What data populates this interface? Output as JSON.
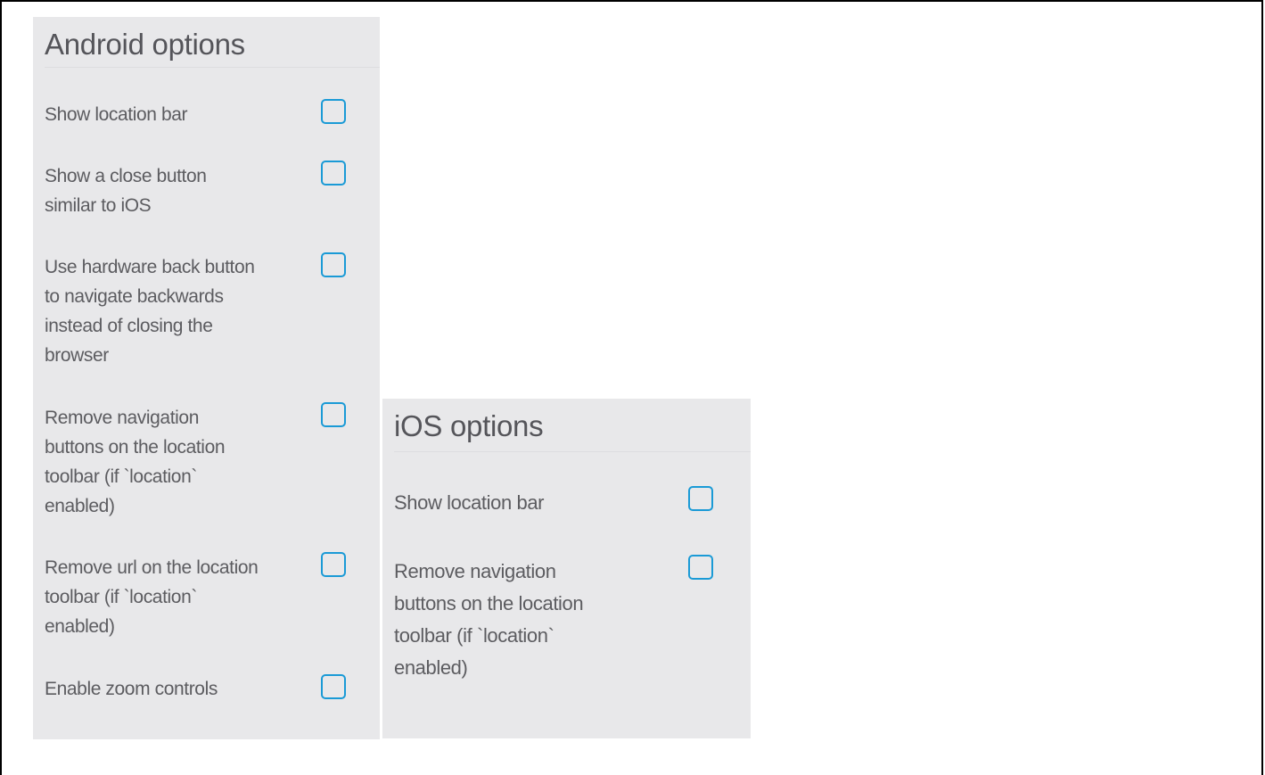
{
  "android": {
    "title": "Android options",
    "options": [
      {
        "label": "Show location bar",
        "checked": false
      },
      {
        "label": "Show a close button similar to iOS",
        "checked": false
      },
      {
        "label": "Use hardware back button to navigate backwards instead of closing the browser",
        "checked": false
      },
      {
        "label": "Remove navigation buttons on the location toolbar (if `location` enabled)",
        "checked": false
      },
      {
        "label": "Remove url on the location toolbar (if `location` enabled)",
        "checked": false
      },
      {
        "label": "Enable zoom controls",
        "checked": false
      }
    ]
  },
  "ios": {
    "title": "iOS options",
    "options": [
      {
        "label": "Show location bar",
        "checked": false
      },
      {
        "label": "Remove navigation buttons on the location toolbar (if `location` enabled)",
        "checked": false
      }
    ]
  },
  "colors": {
    "panel_background": "#e8e8ea",
    "checkbox_border": "#1a9ad6",
    "text": "#5c5c60"
  }
}
